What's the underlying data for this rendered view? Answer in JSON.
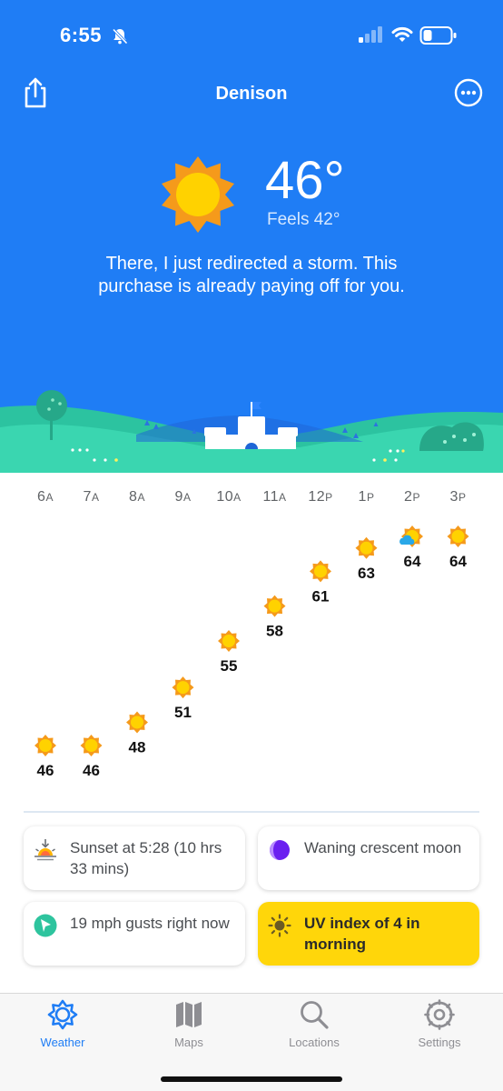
{
  "status_bar": {
    "time": "6:55",
    "icons": [
      "bell-slash-icon",
      "cellular-signal-icon",
      "wifi-icon",
      "battery-icon"
    ]
  },
  "header": {
    "city": "Denison",
    "share_icon": "share-icon",
    "more_icon": "ellipsis-circle-icon"
  },
  "current": {
    "condition_icon": "sun-icon",
    "temperature": "46°",
    "feels_like": "Feels 42°",
    "quip": "There, I just redirected a storm. This purchase is already paying off for you."
  },
  "hourly": [
    {
      "hour": "6",
      "suffix": "A",
      "temp": "46",
      "icon": "sun-icon"
    },
    {
      "hour": "7",
      "suffix": "A",
      "temp": "46",
      "icon": "sun-icon"
    },
    {
      "hour": "8",
      "suffix": "A",
      "temp": "48",
      "icon": "sun-icon"
    },
    {
      "hour": "9",
      "suffix": "A",
      "temp": "51",
      "icon": "sun-icon"
    },
    {
      "hour": "10",
      "suffix": "A",
      "temp": "55",
      "icon": "sun-icon"
    },
    {
      "hour": "11",
      "suffix": "A",
      "temp": "58",
      "icon": "sun-icon"
    },
    {
      "hour": "12",
      "suffix": "P",
      "temp": "61",
      "icon": "sun-icon"
    },
    {
      "hour": "1",
      "suffix": "P",
      "temp": "63",
      "icon": "sun-icon"
    },
    {
      "hour": "2",
      "suffix": "P",
      "temp": "64",
      "icon": "partly-cloudy-icon"
    },
    {
      "hour": "3",
      "suffix": "P",
      "temp": "64",
      "icon": "sun-icon"
    }
  ],
  "cards": {
    "sunset": {
      "icon": "sunset-icon",
      "text": "Sunset at 5:28 (10 hrs 33 mins)"
    },
    "moon": {
      "icon": "moon-phase-icon",
      "text": "Waning crescent moon"
    },
    "gust": {
      "icon": "wind-direction-icon",
      "text": "19 mph gusts right now"
    },
    "uv": {
      "icon": "uv-sun-icon",
      "text": "UV index of 4 in morning",
      "highlight_color": "#ffd60a"
    }
  },
  "tabs": [
    {
      "label": "Weather",
      "icon": "weather-gear-sun-icon",
      "active": true
    },
    {
      "label": "Maps",
      "icon": "map-icon",
      "active": false
    },
    {
      "label": "Locations",
      "icon": "magnifier-icon",
      "active": false
    },
    {
      "label": "Settings",
      "icon": "settings-gear-icon",
      "active": false
    }
  ],
  "colors": {
    "sky": "#1f7df5",
    "active_tab": "#1f7df5",
    "uv_card": "#ffd60a",
    "sun_core": "#ffd200",
    "sun_rays": "#f59a1b"
  }
}
